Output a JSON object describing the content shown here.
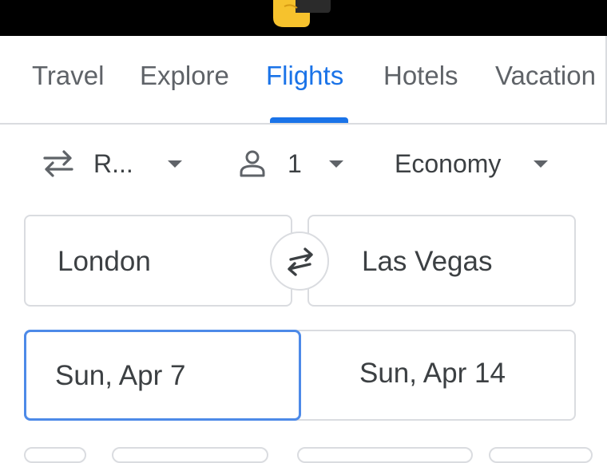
{
  "status_bar": {
    "emoji": "pointing-hand-emoji"
  },
  "nav": {
    "tabs": [
      {
        "label": "Travel",
        "active": false
      },
      {
        "label": "Explore",
        "active": false
      },
      {
        "label": "Flights",
        "active": true
      },
      {
        "label": "Hotels",
        "active": false
      },
      {
        "label": "Vacation",
        "active": false
      }
    ]
  },
  "trip_options": {
    "trip_type": {
      "label": "R...",
      "icon": "round-trip-arrows-icon"
    },
    "passengers": {
      "label": "1",
      "icon": "person-icon"
    },
    "cabin_class": {
      "label": "Economy"
    }
  },
  "route": {
    "origin": "London",
    "destination": "Las Vegas",
    "swap_icon": "swap-arrows-icon"
  },
  "dates": {
    "departure": "Sun, Apr 7",
    "return": "Sun, Apr 14"
  },
  "colors": {
    "accent": "#1a73e8",
    "text": "#3c4043",
    "muted": "#5f6368",
    "border": "#dadce0"
  }
}
